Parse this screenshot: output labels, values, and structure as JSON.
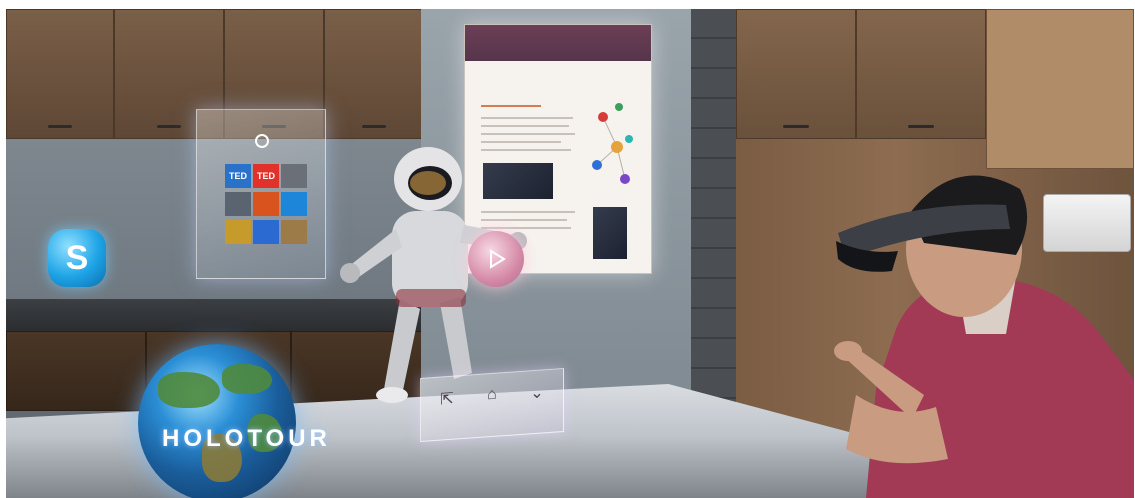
{
  "scene": {
    "holograms": {
      "start_menu_tiles": [
        "TED",
        "TED"
      ],
      "skype_letter": "S",
      "globe_text": "HOLOTOUR",
      "toolbar_icons": [
        "adjust-icon",
        "home-icon",
        "chevron-down-icon"
      ]
    },
    "colors": {
      "skype_blue": "#1ea4e6",
      "document_header": "#6c3f56",
      "shirt": "#a23a55",
      "cabinet_wood": "#7a5f48"
    }
  }
}
